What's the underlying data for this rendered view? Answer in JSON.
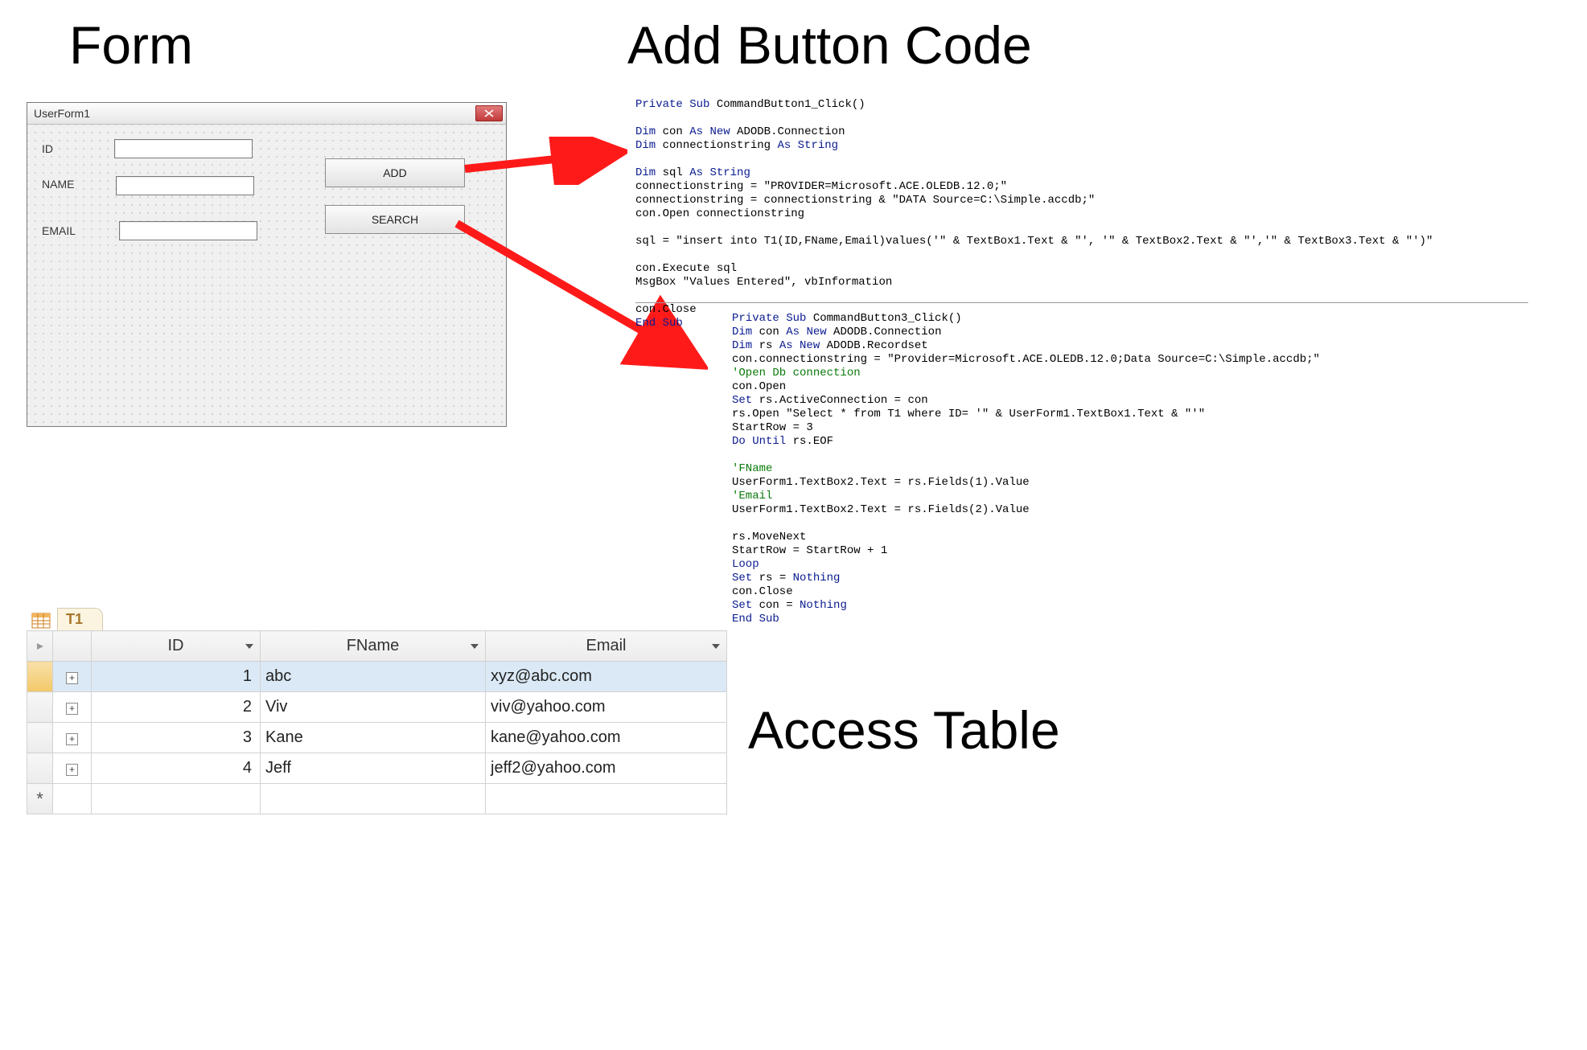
{
  "headings": {
    "form": "Form",
    "add_button_code": "Add Button Code",
    "access_table": "Access Table"
  },
  "userform": {
    "title": "UserForm1",
    "labels": {
      "id": "ID",
      "name": "NAME",
      "email": "EMAIL"
    },
    "fields": {
      "id": "",
      "name": "",
      "email": ""
    },
    "buttons": {
      "add": "ADD",
      "search": "SEARCH"
    }
  },
  "code1": [
    [
      [
        "kw",
        "Private Sub"
      ],
      [
        "",
        " CommandButton1_Click()"
      ]
    ],
    [
      [
        "",
        ""
      ]
    ],
    [
      [
        "kw",
        "Dim"
      ],
      [
        "",
        " con "
      ],
      [
        "kw",
        "As New"
      ],
      [
        "",
        " ADODB.Connection"
      ]
    ],
    [
      [
        "kw",
        "Dim"
      ],
      [
        "",
        " connectionstring "
      ],
      [
        "kw",
        "As String"
      ]
    ],
    [
      [
        "",
        ""
      ]
    ],
    [
      [
        "kw",
        "Dim"
      ],
      [
        "",
        " sql "
      ],
      [
        "kw",
        "As String"
      ]
    ],
    [
      [
        "",
        "connectionstring = \"PROVIDER=Microsoft.ACE.OLEDB.12.0;\""
      ]
    ],
    [
      [
        "",
        "connectionstring = connectionstring & \"DATA Source=C:\\Simple.accdb;\""
      ]
    ],
    [
      [
        "",
        "con.Open connectionstring"
      ]
    ],
    [
      [
        "",
        ""
      ]
    ],
    [
      [
        "",
        "sql = \"insert into T1(ID,FName,Email)values('\" & TextBox1.Text & \"', '\" & TextBox2.Text & \"','\" & TextBox3.Text & \"')\""
      ]
    ],
    [
      [
        "",
        ""
      ]
    ],
    [
      [
        "",
        "con.Execute sql"
      ]
    ],
    [
      [
        "",
        "MsgBox \"Values Entered\", vbInformation"
      ]
    ],
    [
      [
        "",
        ""
      ]
    ],
    [
      [
        "",
        "con.Close"
      ]
    ],
    [
      [
        "kw",
        "End Sub"
      ]
    ]
  ],
  "code2": [
    [
      [
        "kw",
        "Private Sub"
      ],
      [
        "",
        " CommandButton3_Click()"
      ]
    ],
    [
      [
        "kw",
        "Dim"
      ],
      [
        "",
        " con "
      ],
      [
        "kw",
        "As New"
      ],
      [
        "",
        " ADODB.Connection"
      ]
    ],
    [
      [
        "kw",
        "Dim"
      ],
      [
        "",
        " rs "
      ],
      [
        "kw",
        "As New"
      ],
      [
        "",
        " ADODB.Recordset"
      ]
    ],
    [
      [
        "",
        "con.connectionstring = \"Provider=Microsoft.ACE.OLEDB.12.0;Data Source=C:\\Simple.accdb;\""
      ]
    ],
    [
      [
        "cm",
        "'Open Db connection"
      ]
    ],
    [
      [
        "",
        "con.Open"
      ]
    ],
    [
      [
        "kw",
        "Set"
      ],
      [
        "",
        " rs.ActiveConnection = con"
      ]
    ],
    [
      [
        "",
        "rs.Open \"Select * from T1 where ID= '\" & UserForm1.TextBox1.Text & \"'\""
      ]
    ],
    [
      [
        "",
        "StartRow = 3"
      ]
    ],
    [
      [
        "kw",
        "Do Until"
      ],
      [
        "",
        " rs.EOF"
      ]
    ],
    [
      [
        "",
        ""
      ]
    ],
    [
      [
        "cm",
        "'FName"
      ]
    ],
    [
      [
        "",
        "UserForm1.TextBox2.Text = rs.Fields(1).Value"
      ]
    ],
    [
      [
        "cm",
        "'Email"
      ]
    ],
    [
      [
        "",
        "UserForm1.TextBox2.Text = rs.Fields(2).Value"
      ]
    ],
    [
      [
        "",
        ""
      ]
    ],
    [
      [
        "",
        "rs.MoveNext"
      ]
    ],
    [
      [
        "",
        "StartRow = StartRow + 1"
      ]
    ],
    [
      [
        "kw",
        "Loop"
      ]
    ],
    [
      [
        "kw",
        "Set"
      ],
      [
        "",
        " rs = "
      ],
      [
        "kw",
        "Nothing"
      ]
    ],
    [
      [
        "",
        "con.Close"
      ]
    ],
    [
      [
        "kw",
        "Set"
      ],
      [
        "",
        " con = "
      ],
      [
        "kw",
        "Nothing"
      ]
    ],
    [
      [
        "kw",
        "End Sub"
      ]
    ]
  ],
  "access": {
    "tab_name": "T1",
    "columns": [
      "ID",
      "FName",
      "Email"
    ],
    "rows": [
      {
        "id": "1",
        "fname": "abc",
        "email": "xyz@abc.com"
      },
      {
        "id": "2",
        "fname": "Viv",
        "email": "viv@yahoo.com"
      },
      {
        "id": "3",
        "fname": "Kane",
        "email": "kane@yahoo.com"
      },
      {
        "id": "4",
        "fname": "Jeff",
        "email": "jeff2@yahoo.com"
      }
    ]
  }
}
